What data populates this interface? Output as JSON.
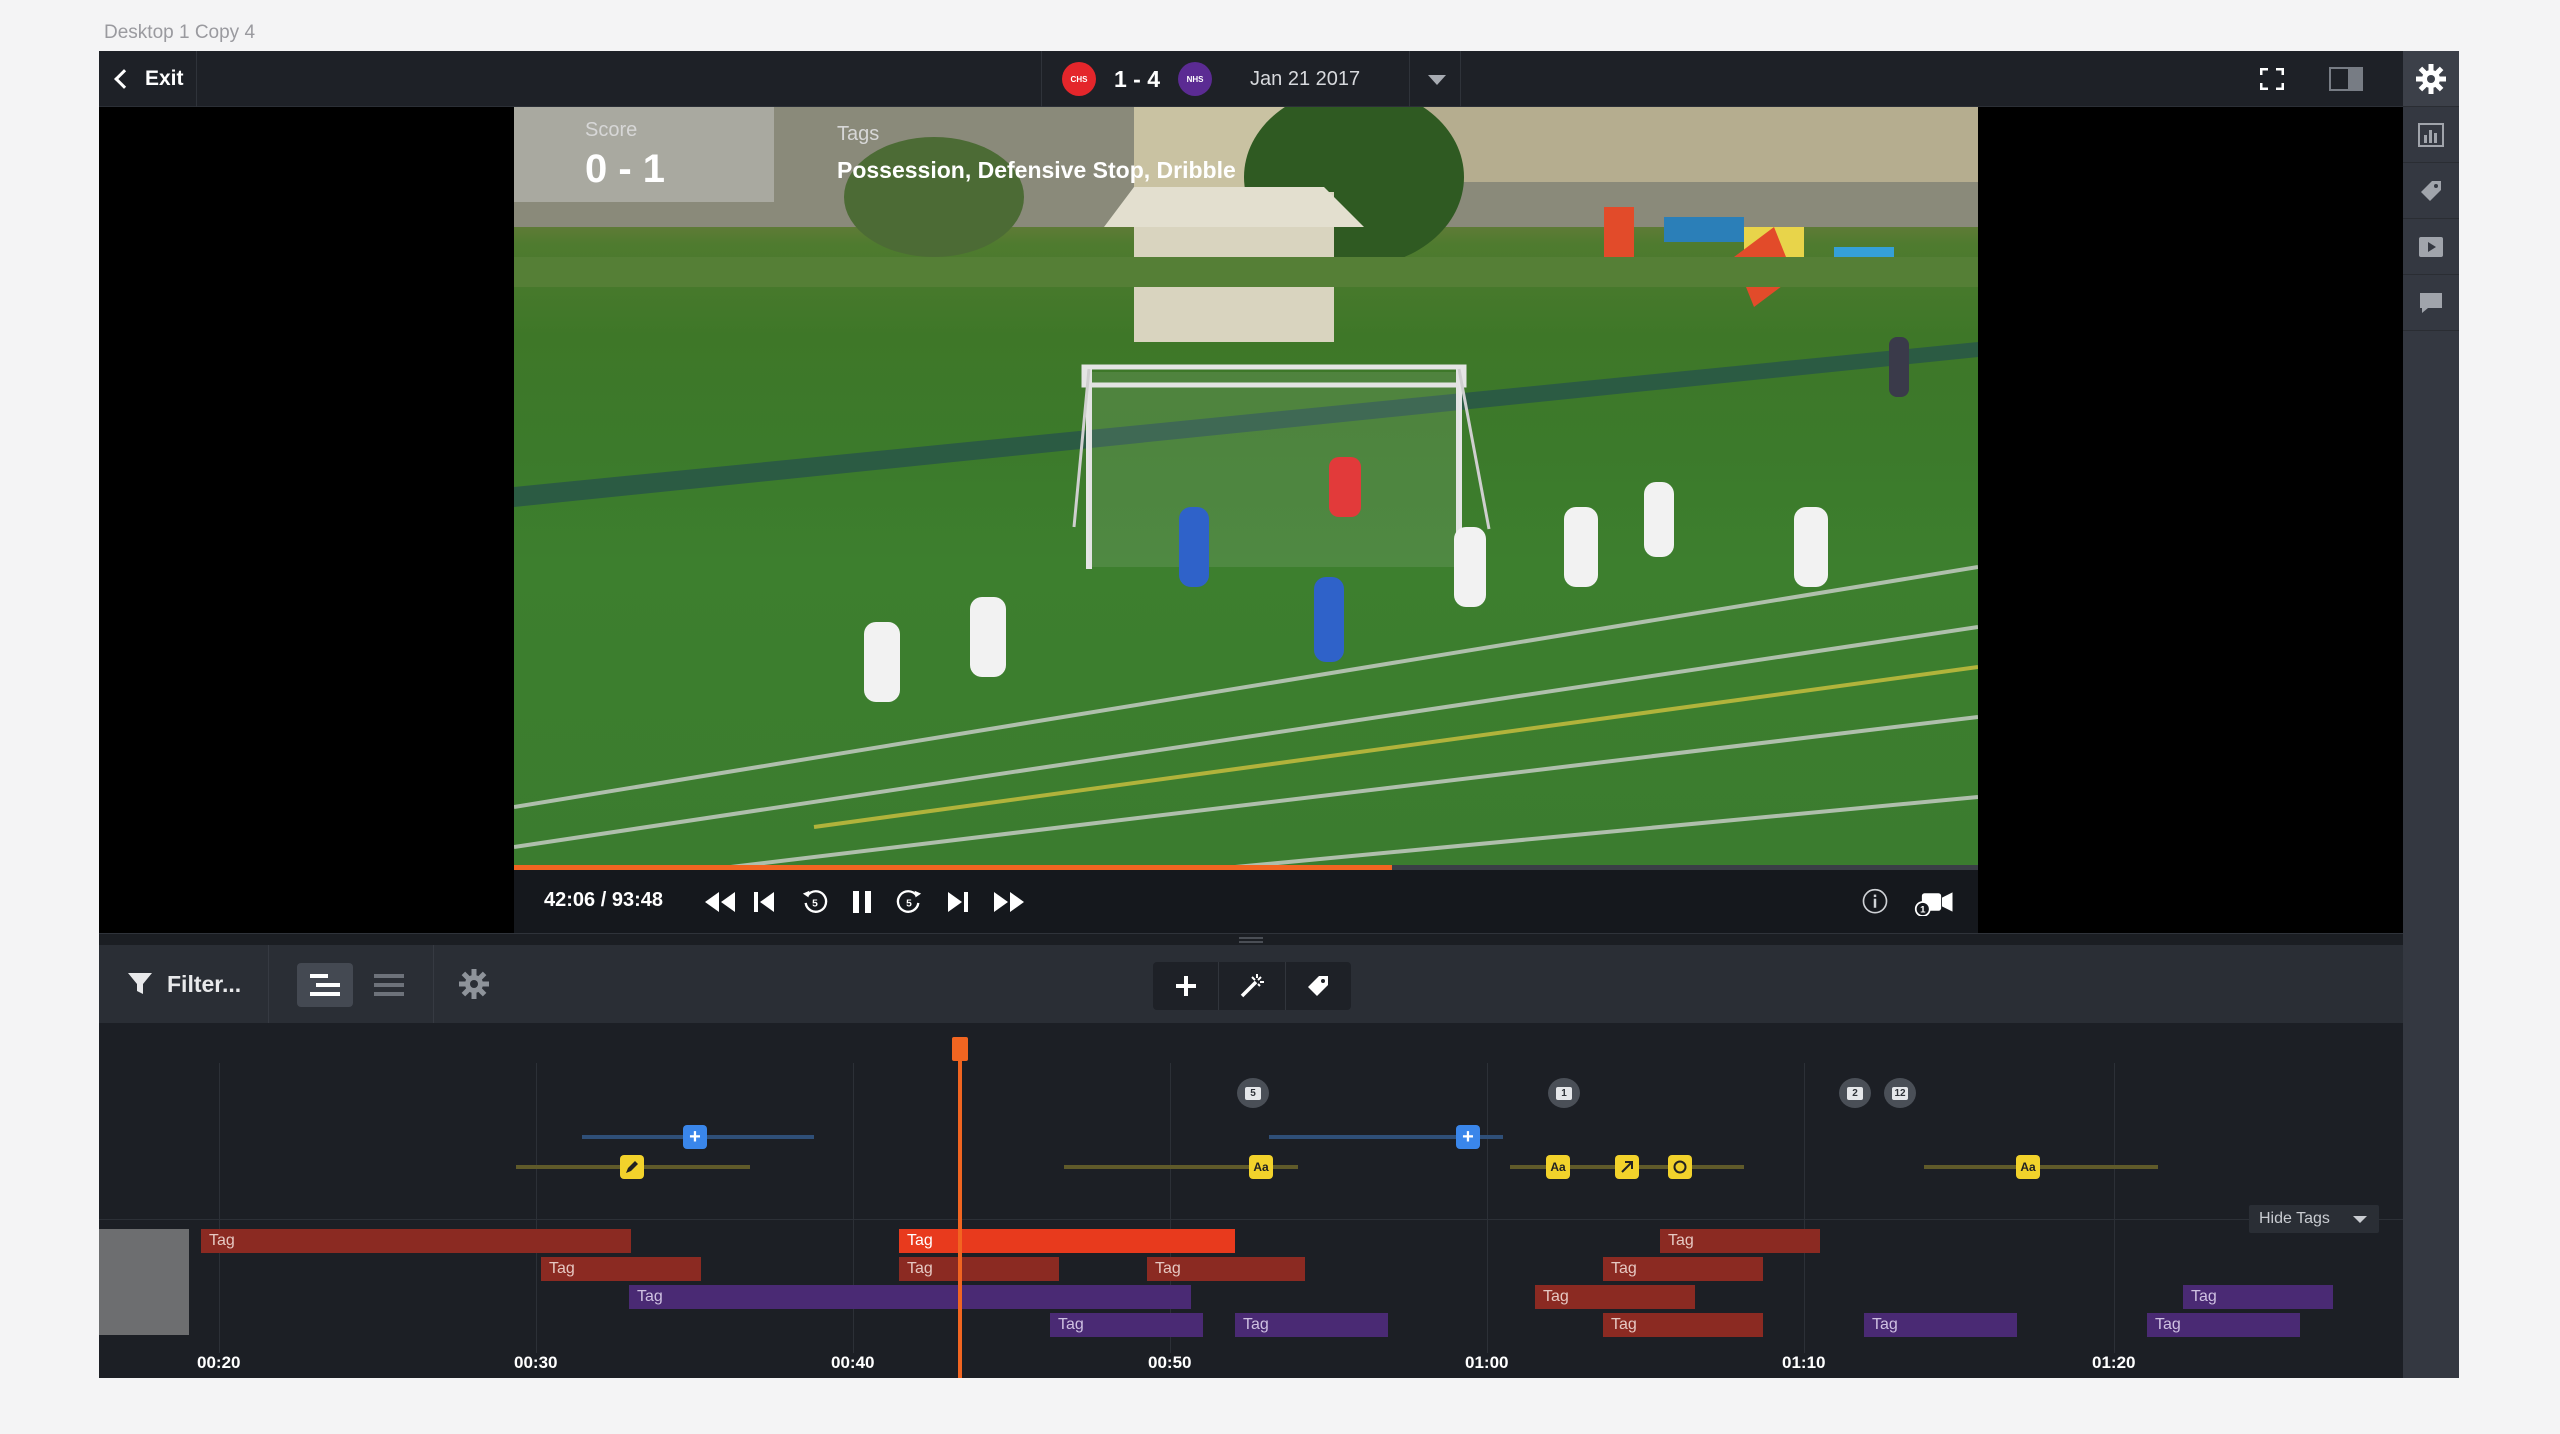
{
  "canvas_label": "Desktop 1 Copy 4",
  "topbar": {
    "exit_label": "Exit",
    "home_team_abbr": "CHS",
    "away_team_abbr": "NHS",
    "score": "1 - 4",
    "date": "Jan 21 2017"
  },
  "video": {
    "score_label": "Score",
    "score_value": "0 - 1",
    "tags_label": "Tags",
    "tags_value": "Possession, Defensive Stop, Dribble",
    "time": "42:06 / 93:48",
    "progress": 0.6
  },
  "toolbar": {
    "filter_label": "Filter..."
  },
  "timeline": {
    "hide_tags_label": "Hide Tags",
    "ticks": [
      "00:20",
      "00:30",
      "00:40",
      "00:50",
      "01:00",
      "01:10",
      "01:20"
    ],
    "tag_label": "Tag",
    "comments": [
      "5",
      "1",
      "2",
      "12"
    ],
    "text_marker_label": "Aa"
  },
  "colors": {
    "accent": "#f16521",
    "tag_red": "#8b2a22",
    "tag_red_selected": "#e83a1d",
    "tag_purple": "#4a2a74",
    "marker_blue": "#3a86ea",
    "marker_yellow": "#f2d22b"
  }
}
